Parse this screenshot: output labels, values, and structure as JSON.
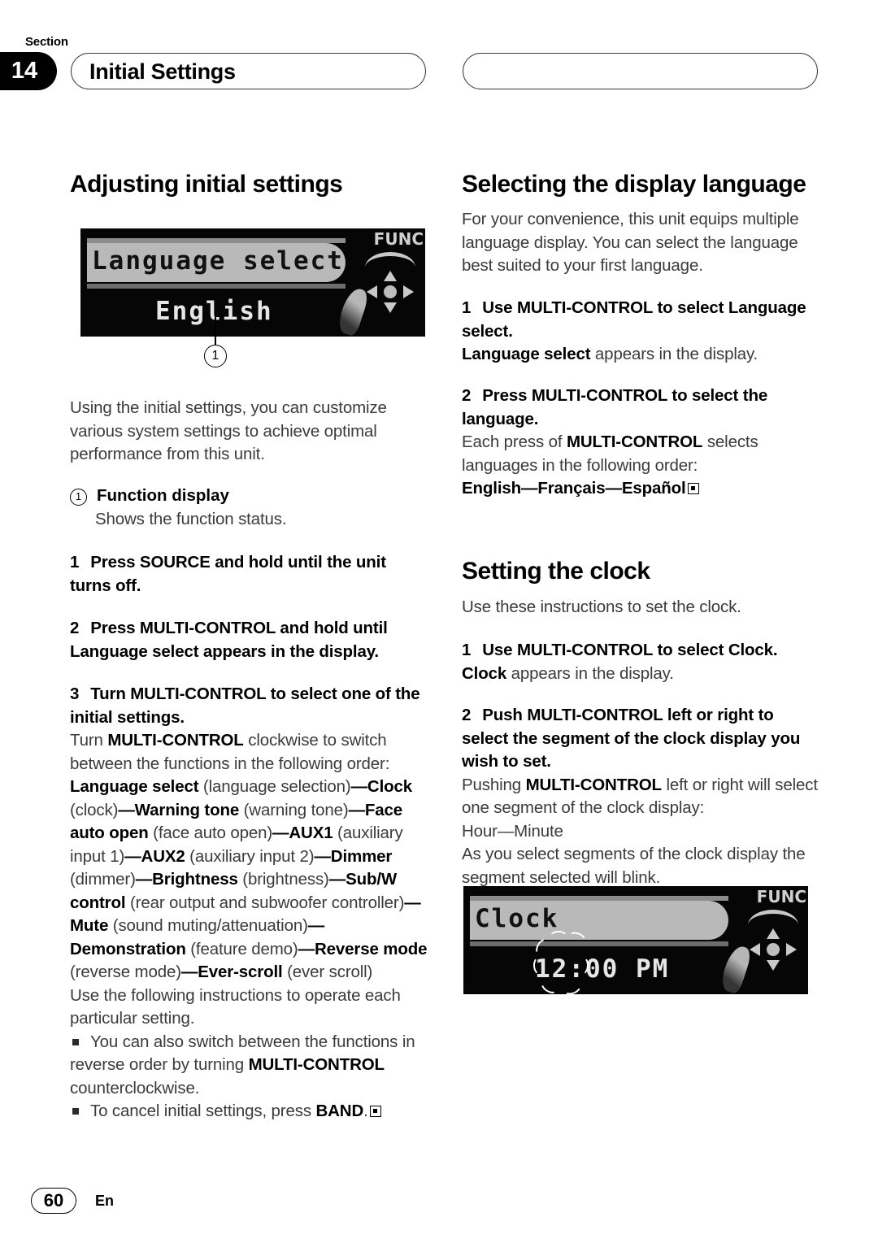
{
  "header": {
    "section_word": "Section",
    "section_number": "14",
    "title": "Initial Settings",
    "right_pill_title": ""
  },
  "left_column": {
    "heading": "Adjusting initial settings",
    "figure": {
      "name": "language-select-display",
      "title_text": "Language select",
      "sub_text": "English",
      "func_label": "FUNC",
      "callout_number": "1"
    },
    "intro": "Using the initial settings, you can customize various system settings to achieve optimal performance from this unit.",
    "callout": {
      "number": "1",
      "label": "Function display",
      "description": "Shows the function status."
    },
    "steps": [
      {
        "num": "1",
        "bold_text": "Press SOURCE and hold until the unit turns off."
      },
      {
        "num": "2",
        "bold_text": "Press MULTI-CONTROL and hold until Language select appears in the display."
      },
      {
        "num": "3",
        "bold_text": "Turn MULTI-CONTROL to select one of the initial settings."
      }
    ],
    "order_intro_a": "Turn ",
    "order_intro_b": "MULTI-CONTROL",
    "order_intro_c": " clockwise to switch between the functions in the following order:",
    "settings_order": [
      {
        "name": "Language select",
        "paren": " (language selection)"
      },
      {
        "name": "Clock",
        "paren": " (clock)"
      },
      {
        "name": "Warning tone",
        "paren": " (warning tone)"
      },
      {
        "name": "Face auto open",
        "paren": " (face auto open)"
      },
      {
        "name": "AUX1",
        "paren": " (auxiliary input 1)"
      },
      {
        "name": "AUX2",
        "paren": " (auxiliary input 2)"
      },
      {
        "name": "Dimmer",
        "paren": " (dimmer)"
      },
      {
        "name": "Brightness",
        "paren": " (brightness)"
      },
      {
        "name": "Sub/W control",
        "paren": " (rear output and subwoofer controller)"
      },
      {
        "name": "Mute",
        "paren": " (sound muting/attenuation)"
      },
      {
        "name": "Demonstration",
        "paren": " (feature demo)"
      },
      {
        "name": "Reverse mode",
        "paren": " (reverse mode)"
      },
      {
        "name": "Ever-scroll",
        "paren": " (ever scroll)"
      }
    ],
    "after_order": "Use the following instructions to operate each particular setting.",
    "notes": [
      {
        "text_a": "You can also switch between the functions in reverse order by turning ",
        "bold": "MULTI-CONTROL",
        "text_b": " counterclockwise.",
        "endmark": false
      },
      {
        "text_a": "To cancel initial settings, press ",
        "bold": "BAND",
        "text_b": ".",
        "endmark": true
      }
    ]
  },
  "right_column": {
    "section_language": {
      "heading": "Selecting the display language",
      "intro": "For your convenience, this unit equips multiple language display. You can select the language best suited to your first language.",
      "steps": [
        {
          "num": "1",
          "bold_text": "Use MULTI-CONTROL to select Language select.",
          "follow_bold": "Language select",
          "follow_rest": " appears in the display."
        },
        {
          "num": "2",
          "bold_text": "Press MULTI-CONTROL to select the language.",
          "follow_a": "Each press of ",
          "follow_bold": "MULTI-CONTROL",
          "follow_b": " selects languages in the following order:"
        }
      ],
      "language_order": [
        "English",
        "Français",
        "Español"
      ],
      "language_separator": "—"
    },
    "section_clock": {
      "heading": "Setting the clock",
      "intro": "Use these instructions to set the clock.",
      "steps": [
        {
          "num": "1",
          "bold_text": "Use MULTI-CONTROL to select Clock.",
          "follow_bold": "Clock",
          "follow_rest": " appears in the display."
        },
        {
          "num": "2",
          "bold_text": "Push MULTI-CONTROL left or right to select the segment of the clock display you wish to set.",
          "follow_a": "Pushing ",
          "follow_bold": "MULTI-CONTROL",
          "follow_b": " left or right will select one segment of the clock display:",
          "segments": "Hour—Minute",
          "follow_c": "As you select segments of the clock display the segment selected will blink."
        }
      ],
      "figure": {
        "name": "clock-display",
        "title_text": "Clock",
        "sub_text": "12:00 PM",
        "func_label": "FUNC"
      }
    }
  },
  "footer": {
    "page_number": "60",
    "language_code": "En"
  }
}
